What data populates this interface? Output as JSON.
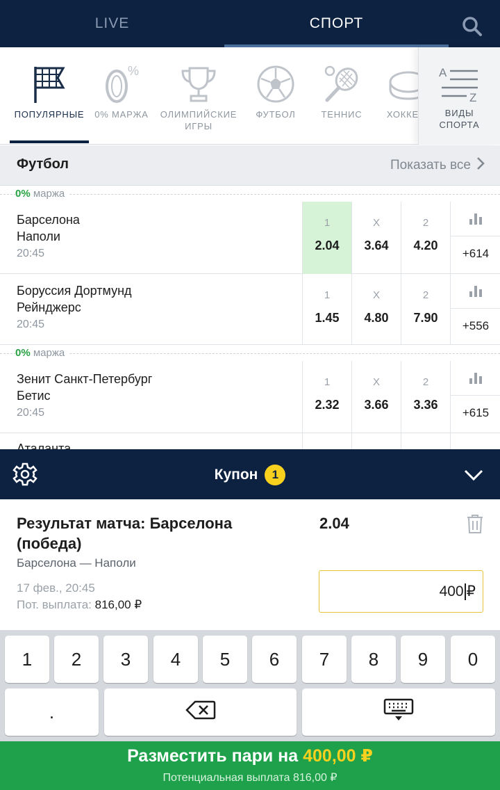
{
  "topnav": {
    "live_label": "LIVE",
    "sport_label": "СПОРТ"
  },
  "categories": [
    {
      "label": "ПОПУЛЯРНЫЕ",
      "icon": "flag-grid-icon",
      "active": true
    },
    {
      "label": "0% МАРЖА",
      "icon": "zero-percent-icon"
    },
    {
      "label": "ОЛИМПИЙСКИЕ\nИГРЫ",
      "icon": "trophy-icon"
    },
    {
      "label": "ФУТБОЛ",
      "icon": "soccer-ball-icon"
    },
    {
      "label": "ТЕННИС",
      "icon": "tennis-racket-icon"
    },
    {
      "label": "ХОККЕЙ",
      "icon": "hockey-puck-icon"
    }
  ],
  "kinds": {
    "label_1": "ВИДЫ",
    "label_2": "СПОРТА",
    "icon": "sort-az-icon"
  },
  "section": {
    "title": "Футбол",
    "show_all": "Показать все"
  },
  "margin_tag": {
    "pct": "0%",
    "text": " маржа"
  },
  "matches": [
    {
      "home": "Барселона",
      "away": "Наполи",
      "time": "20:45",
      "margin": true,
      "odds": [
        {
          "k": "1",
          "v": "2.04",
          "selected": true
        },
        {
          "k": "X",
          "v": "3.64"
        },
        {
          "k": "2",
          "v": "4.20"
        }
      ],
      "more": "+614"
    },
    {
      "home": "Боруссия Дортмунд",
      "away": "Рейнджерс",
      "time": "20:45",
      "margin": false,
      "odds": [
        {
          "k": "1",
          "v": "1.45"
        },
        {
          "k": "X",
          "v": "4.80"
        },
        {
          "k": "2",
          "v": "7.90"
        }
      ],
      "more": "+556"
    },
    {
      "home": "Зенит Санкт-Петербург",
      "away": "Бетис",
      "time": "20:45",
      "margin": true,
      "odds": [
        {
          "k": "1",
          "v": "2.32"
        },
        {
          "k": "X",
          "v": "3.66"
        },
        {
          "k": "2",
          "v": "3.36"
        }
      ],
      "more": "+615"
    },
    {
      "home": "Аталанта",
      "away": "",
      "time": "",
      "margin": false,
      "odds": [],
      "more": ""
    }
  ],
  "coupon": {
    "title": "Купон",
    "count": "1"
  },
  "bet": {
    "title": "Результат матча: Барселона (победа)",
    "odd": "2.04",
    "event": "Барселона — Наполи",
    "date": "17 фев., 20:45",
    "payout_label": "Пот. выплата: ",
    "payout_value": "816,00 ₽",
    "stake": "400",
    "currency": "₽"
  },
  "keyboard": {
    "digits": [
      "1",
      "2",
      "3",
      "4",
      "5",
      "6",
      "7",
      "8",
      "9",
      "0"
    ],
    "dot": "."
  },
  "place": {
    "label": "Разместить пари на ",
    "amount": "400,00 ₽",
    "sub": "Потенциальная выплата 816,00 ₽"
  },
  "colors": {
    "navy": "#0d2240",
    "green": "#1ea14a",
    "yellow": "#f7d11e",
    "selected_odd": "#d6f2d7"
  }
}
